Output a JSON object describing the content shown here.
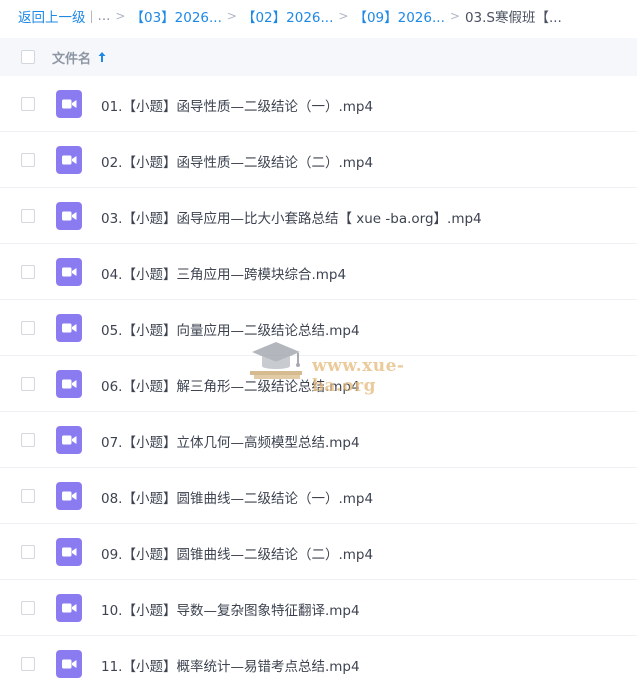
{
  "breadcrumb": {
    "back": "返回上一级",
    "divider": "|",
    "ellipsis": "...",
    "items": [
      "【03】2026...",
      "【02】2026...",
      "【09】2026..."
    ],
    "current": "03.S寒假班【..."
  },
  "header": {
    "column_label": "文件名"
  },
  "files": [
    {
      "name": "01.【小题】函导性质—二级结论（一）.mp4"
    },
    {
      "name": "02.【小题】函导性质—二级结论（二）.mp4"
    },
    {
      "name": "03.【小题】函导应用—比大小套路总结【 xue -ba.org】.mp4"
    },
    {
      "name": "04.【小题】三角应用—跨模块综合.mp4"
    },
    {
      "name": "05.【小题】向量应用—二级结论总结.mp4"
    },
    {
      "name": "06.【小题】解三角形—二级结论总结.mp4"
    },
    {
      "name": "07.【小题】立体几何—高频模型总结.mp4"
    },
    {
      "name": "08.【小题】圆锥曲线—二级结论（一）.mp4"
    },
    {
      "name": "09.【小题】圆锥曲线—二级结论（二）.mp4"
    },
    {
      "name": "10.【小题】导数—复杂图象特征翻译.mp4"
    },
    {
      "name": "11.【小题】概率统计—易错考点总结.mp4"
    }
  ],
  "watermark": {
    "text": "www.xue-ba.org"
  },
  "colors": {
    "link": "#1e88e5",
    "video_icon": "#8a7cf0",
    "header_bg": "#f6f7fa"
  }
}
